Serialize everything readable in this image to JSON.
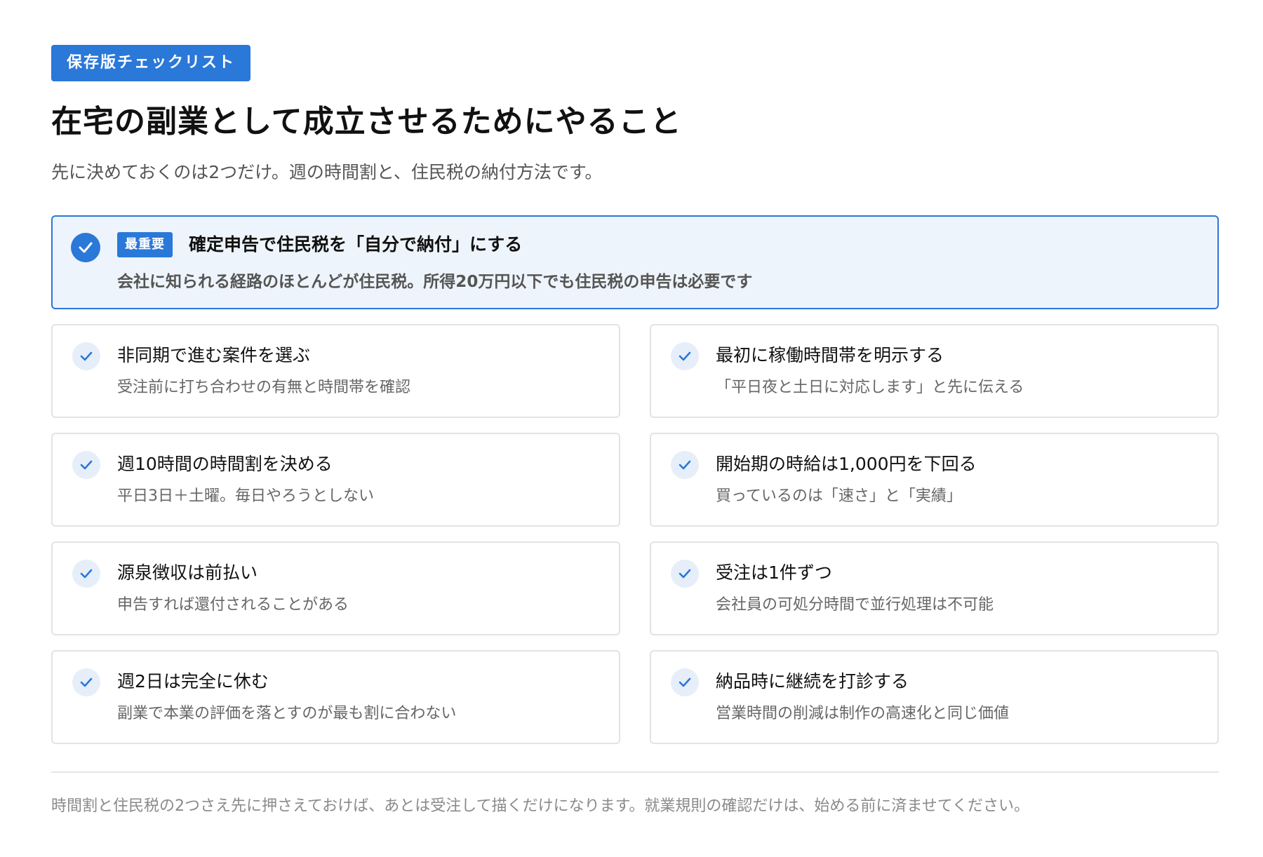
{
  "header": {
    "tag": "保存版チェックリスト",
    "title": "在宅の副業として成立させるためにやること",
    "subtitle": "先に決めておくのは2つだけ。週の時間割と、住民税の納付方法です。"
  },
  "hero": {
    "icon": "check-circle-icon",
    "badge": "最重要",
    "title": "確定申告で住民税を「自分で納付」にする",
    "description": "会社に知られる経路のほとんどが住民税。所得20万円以下でも住民税の申告は必要です"
  },
  "items": [
    {
      "title": "非同期で進む案件を選ぶ",
      "description": "受注前に打ち合わせの有無と時間帯を確認"
    },
    {
      "title": "最初に稼働時間帯を明示する",
      "description": "「平日夜と土日に対応します」と先に伝える"
    },
    {
      "title": "週10時間の時間割を決める",
      "description": "平日3日＋土曜。毎日やろうとしない"
    },
    {
      "title": "開始期の時給は1,000円を下回る",
      "description": "買っているのは「速さ」と「実績」"
    },
    {
      "title": "源泉徴収は前払い",
      "description": "申告すれば還付されることがある"
    },
    {
      "title": "受注は1件ずつ",
      "description": "会社員の可処分時間で並行処理は不可能"
    },
    {
      "title": "週2日は完全に休む",
      "description": "副業で本業の評価を落とすのが最も割に合わない"
    },
    {
      "title": "納品時に継続を打診する",
      "description": "営業時間の削減は制作の高速化と同じ価値"
    }
  ],
  "footer": {
    "text": "時間割と住民税の2つさえ先に押さえておけば、あとは受注して描くだけになります。就業規則の確認だけは、始める前に済ませてください。"
  },
  "colors": {
    "accent": "#2a78d8",
    "hero_background": "#eef4fb",
    "check_background": "#e6eef9",
    "card_border": "#e3e3e3"
  }
}
